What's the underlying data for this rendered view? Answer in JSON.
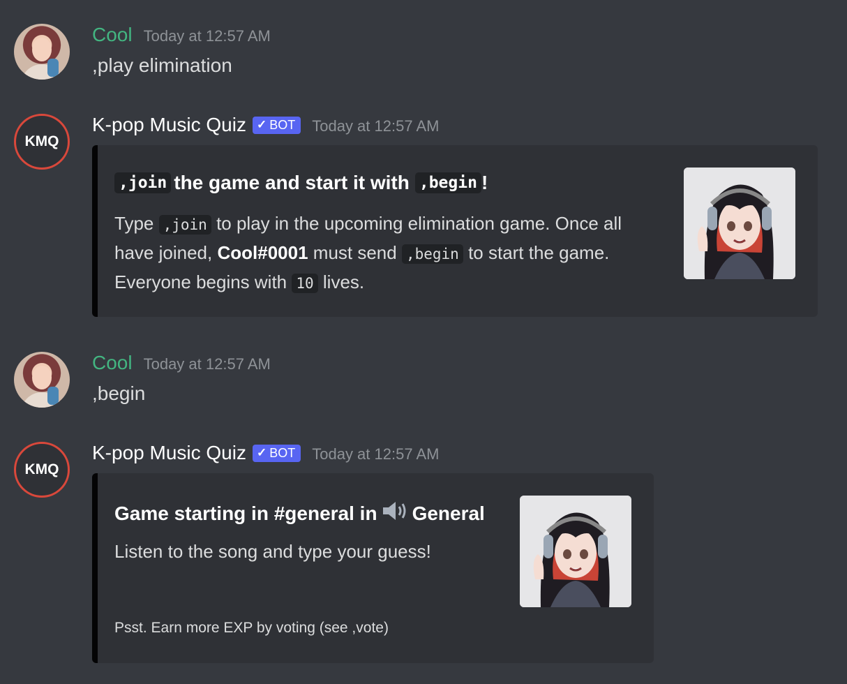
{
  "messages": [
    {
      "author": "Cool",
      "timestamp": "Today at 12:57 AM",
      "text": ",play elimination"
    },
    {
      "author": "K-pop Music Quiz",
      "bot_badge": "BOT",
      "avatar_text": "KMQ",
      "timestamp": "Today at 12:57 AM",
      "embed": {
        "title_code_1": ",join",
        "title_text_1": "the game and start it with",
        "title_code_2": ",begin",
        "title_text_2": "!",
        "desc_1": "Type",
        "desc_code_1": ",join",
        "desc_2": "to play in the upcoming elimination game. Once all have joined,",
        "desc_bold": "Cool#0001",
        "desc_3": "must send",
        "desc_code_2": ",begin",
        "desc_4": "to start the game. Everyone begins with",
        "desc_code_3": "10",
        "desc_5": "lives."
      }
    },
    {
      "author": "Cool",
      "timestamp": "Today at 12:57 AM",
      "text": ",begin"
    },
    {
      "author": "K-pop Music Quiz",
      "bot_badge": "BOT",
      "avatar_text": "KMQ",
      "timestamp": "Today at 12:57 AM",
      "embed": {
        "title_1": "Game starting in #general in",
        "title_icon": "speaker-icon",
        "title_2": "General",
        "desc": "Listen to the song and type your guess!",
        "footer": "Psst. Earn more EXP by voting (see ,vote)"
      }
    }
  ],
  "colors": {
    "background": "#36393f",
    "embed_bg": "#2f3136",
    "user_green": "#43b581",
    "bot_badge": "#5865f2",
    "kmq_ring": "#d9483b"
  }
}
